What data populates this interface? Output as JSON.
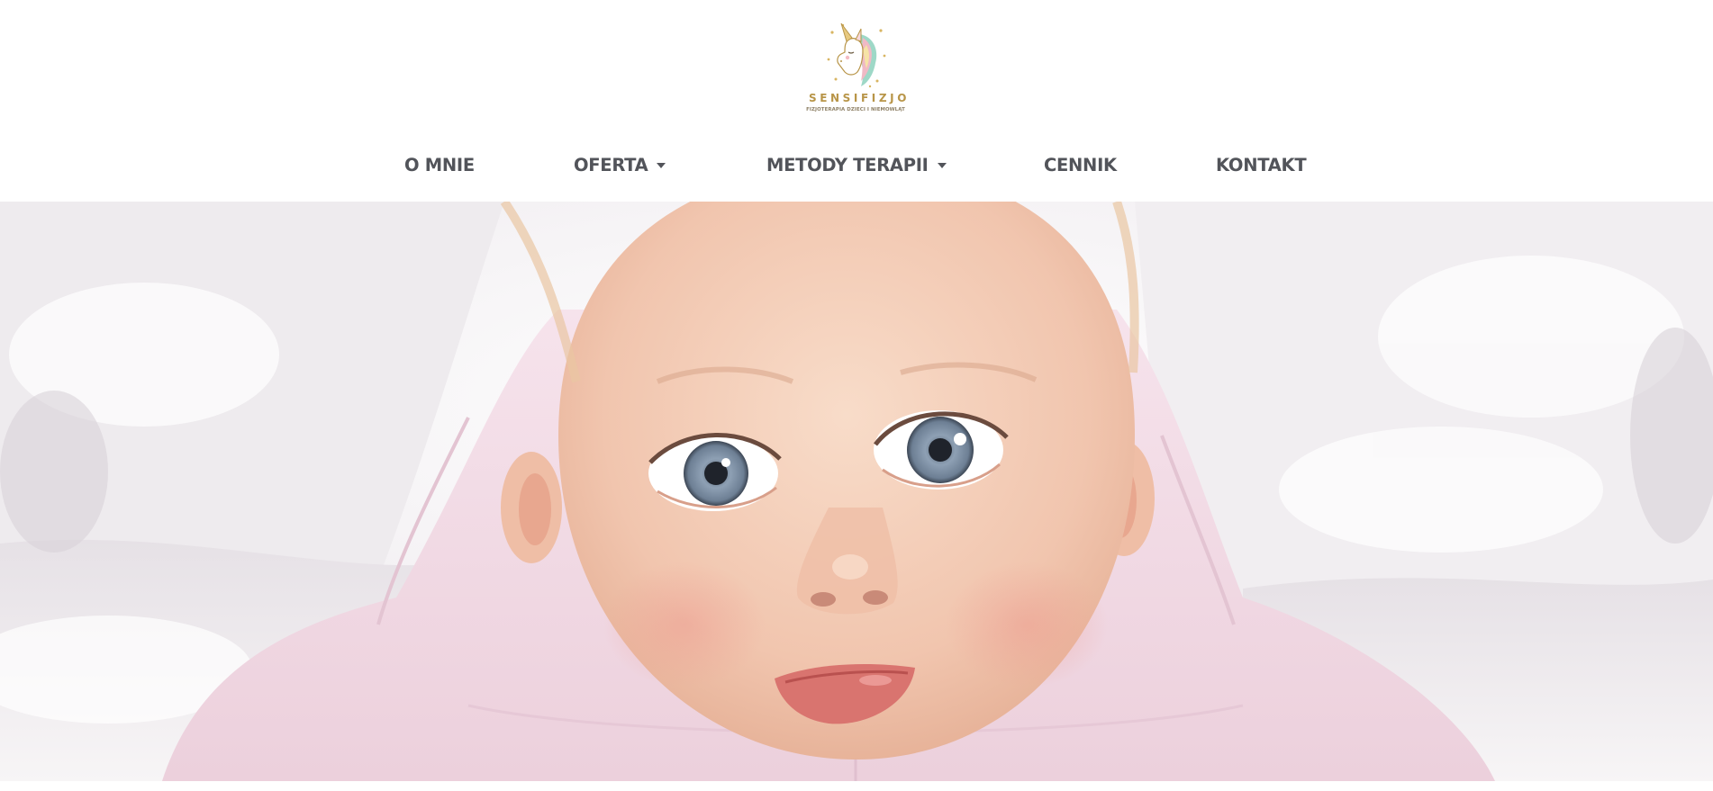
{
  "brand": {
    "name": "SENSIFIZJO",
    "tagline": "FIZJOTERAPIA DZIECI I NIEMOWLĄT",
    "logo_icon": "unicorn-head-icon",
    "colors": {
      "gold": "#b89548",
      "mint": "#9ed8c7",
      "pink": "#f0b9c5"
    }
  },
  "nav": {
    "items": [
      {
        "label": "O MNIE",
        "has_dropdown": false
      },
      {
        "label": "OFERTA",
        "has_dropdown": true
      },
      {
        "label": "METODY TERAPII",
        "has_dropdown": true
      },
      {
        "label": "CENNIK",
        "has_dropdown": false
      },
      {
        "label": "KONTAKT",
        "has_dropdown": false
      }
    ],
    "text_color": "#52545a",
    "dropdown_icon": "caret-down-icon"
  },
  "hero": {
    "image": "baby-portrait-photo",
    "colors": {
      "background": "#f1eef1",
      "skin": "#f2c9b3",
      "onesie": "#f3dbe6",
      "eyes": "#7d8fa4"
    }
  }
}
